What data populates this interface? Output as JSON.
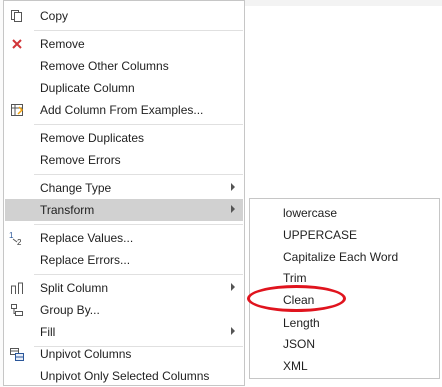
{
  "context_menu": {
    "items": [
      {
        "label": "Copy"
      },
      {
        "label": "Remove"
      },
      {
        "label": "Remove Other Columns"
      },
      {
        "label": "Duplicate Column"
      },
      {
        "label": "Add Column From Examples..."
      },
      {
        "label": "Remove Duplicates"
      },
      {
        "label": "Remove Errors"
      },
      {
        "label": "Change Type"
      },
      {
        "label": "Transform"
      },
      {
        "label": "Replace Values..."
      },
      {
        "label": "Replace Errors..."
      },
      {
        "label": "Split Column"
      },
      {
        "label": "Group By..."
      },
      {
        "label": "Fill"
      },
      {
        "label": "Unpivot Columns"
      },
      {
        "label": "Unpivot Only Selected Columns"
      }
    ]
  },
  "transform_submenu": {
    "items": [
      {
        "label": "lowercase"
      },
      {
        "label": "UPPERCASE"
      },
      {
        "label": "Capitalize Each Word"
      },
      {
        "label": "Trim"
      },
      {
        "label": "Clean"
      },
      {
        "label": "Length"
      },
      {
        "label": "JSON"
      },
      {
        "label": "XML"
      }
    ],
    "highlighted": "Clean"
  },
  "colors": {
    "menu_border": "#c6c6c6",
    "active_background": "#d1d1d1",
    "annotation_circle": "#e0141e",
    "remove_icon": "#d13438",
    "accent_yellow": "#f2c811"
  }
}
